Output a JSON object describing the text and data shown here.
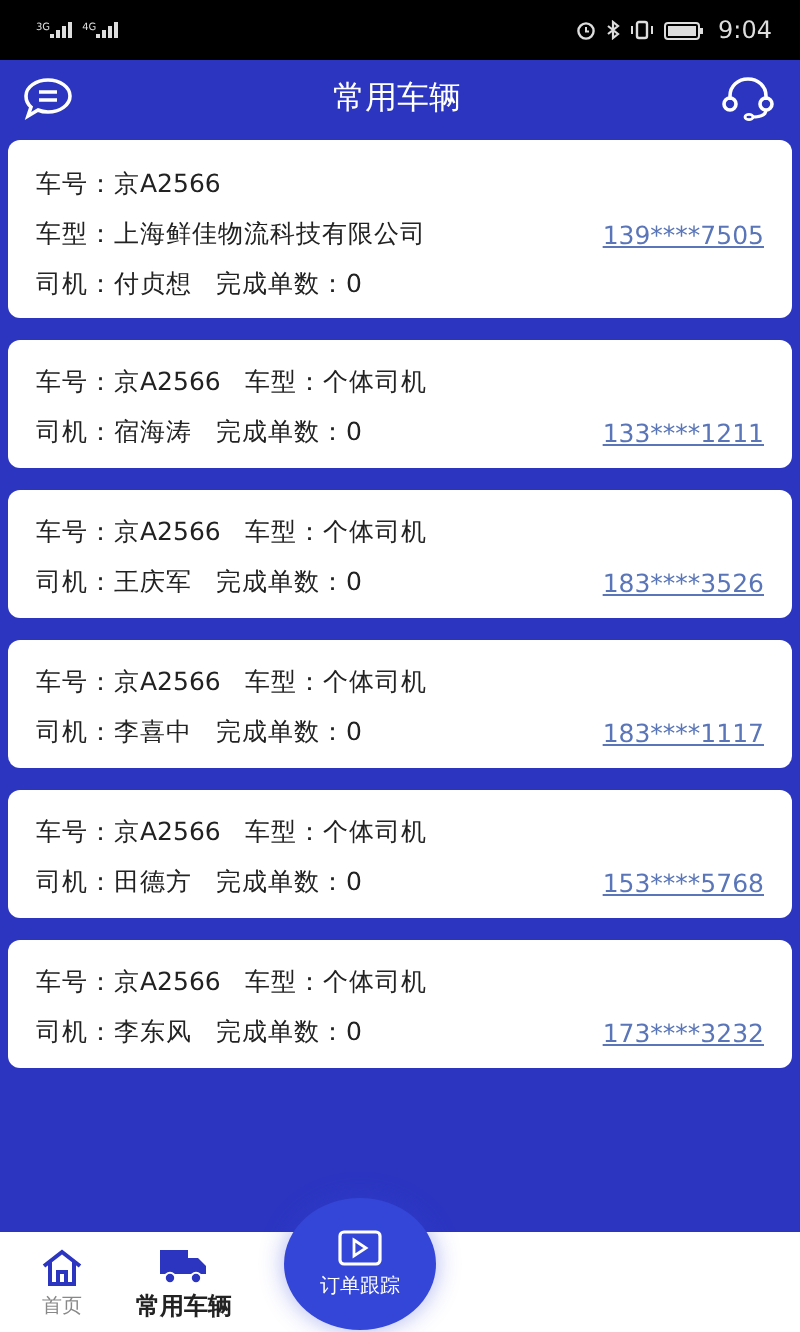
{
  "status_bar": {
    "time": "9:04",
    "signal_labels": [
      "3G",
      "4G"
    ]
  },
  "header": {
    "title": "常用车辆"
  },
  "vehicles": [
    {
      "plate_label": "车号：",
      "plate": "京A2566",
      "type_label": "车型：",
      "type": "上海鲜佳物流科技有限公司",
      "driver_label": "司机：",
      "driver": "付贞想",
      "orders_label": "完成单数：",
      "orders": "0",
      "phone": "139****7505",
      "kind": "company"
    },
    {
      "plate_label": "车号：",
      "plate": "京A2566",
      "type_label": "车型：",
      "type": "个体司机",
      "driver_label": "司机：",
      "driver": "宿海涛",
      "orders_label": "完成单数：",
      "orders": "0",
      "phone": "133****1211",
      "kind": "individual"
    },
    {
      "plate_label": "车号：",
      "plate": "京A2566",
      "type_label": "车型：",
      "type": "个体司机",
      "driver_label": "司机：",
      "driver": "王庆军",
      "orders_label": "完成单数：",
      "orders": "0",
      "phone": "183****3526",
      "kind": "individual"
    },
    {
      "plate_label": "车号：",
      "plate": "京A2566",
      "type_label": "车型：",
      "type": "个体司机",
      "driver_label": "司机：",
      "driver": "李喜中",
      "orders_label": "完成单数：",
      "orders": "0",
      "phone": "183****1117",
      "kind": "individual"
    },
    {
      "plate_label": "车号：",
      "plate": "京A2566",
      "type_label": "车型：",
      "type": "个体司机",
      "driver_label": "司机：",
      "driver": "田德方",
      "orders_label": "完成单数：",
      "orders": "0",
      "phone": "153****5768",
      "kind": "individual"
    },
    {
      "plate_label": "车号：",
      "plate": "京A2566",
      "type_label": "车型：",
      "type": "个体司机",
      "driver_label": "司机：",
      "driver": "李东风",
      "orders_label": "完成单数：",
      "orders": "0",
      "phone": "173****3232",
      "kind": "individual"
    }
  ],
  "tab_bar": [
    {
      "label": "首页",
      "selected": false,
      "kind": "home"
    },
    {
      "label": "常用车辆",
      "selected": true,
      "kind": "truck"
    },
    {
      "label": "订单跟踪",
      "selected": false,
      "kind": "center"
    }
  ]
}
